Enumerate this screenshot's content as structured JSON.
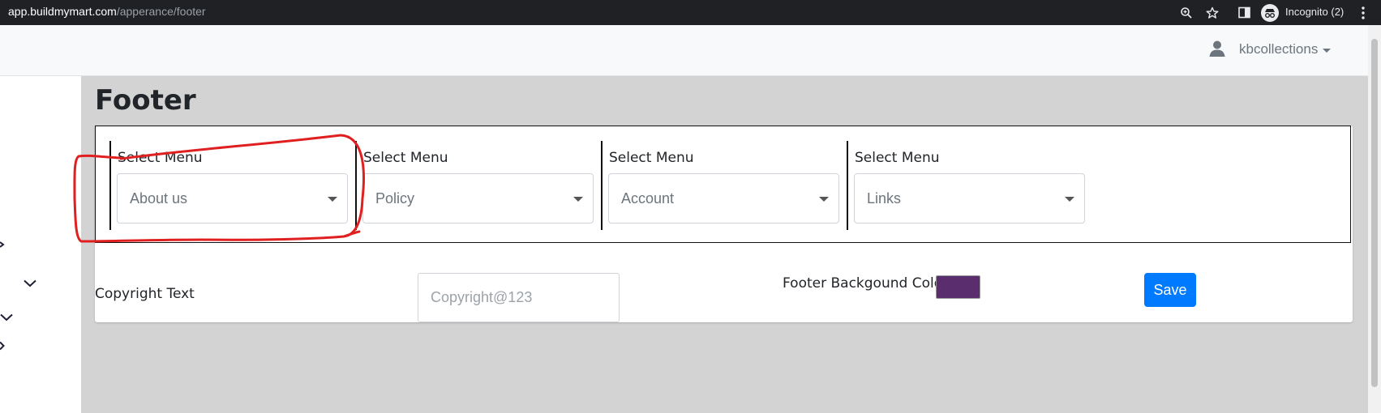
{
  "browser": {
    "url_host": "app.buildmymart.com",
    "url_path": "/apperance/footer",
    "incognito_label": "Incognito (2)",
    "icons": [
      "zoom-icon",
      "star-icon",
      "sidebar-toggle-icon",
      "incognito-icon",
      "kebab-menu-icon"
    ]
  },
  "header": {
    "user_name": "kbcollections",
    "icons": [
      "user-icon",
      "caret-down-icon"
    ]
  },
  "page": {
    "title": "Footer"
  },
  "menus": [
    {
      "label": "Select Menu",
      "selected": "About us"
    },
    {
      "label": "Select Menu",
      "selected": "Policy"
    },
    {
      "label": "Select Menu",
      "selected": "Account"
    },
    {
      "label": "Select Menu",
      "selected": "Links"
    }
  ],
  "copyright": {
    "label": "Copyright Text",
    "placeholder": "Copyright@123"
  },
  "footer_bg": {
    "label": "Footer Backgound Color",
    "color": "#5a2d6e"
  },
  "save": {
    "label": "Save"
  },
  "colors": {
    "accent": "#007bff",
    "page_background": "#d3d3d3",
    "annotation": "#e02020",
    "sidebar_icon": "#1f1f3a"
  }
}
